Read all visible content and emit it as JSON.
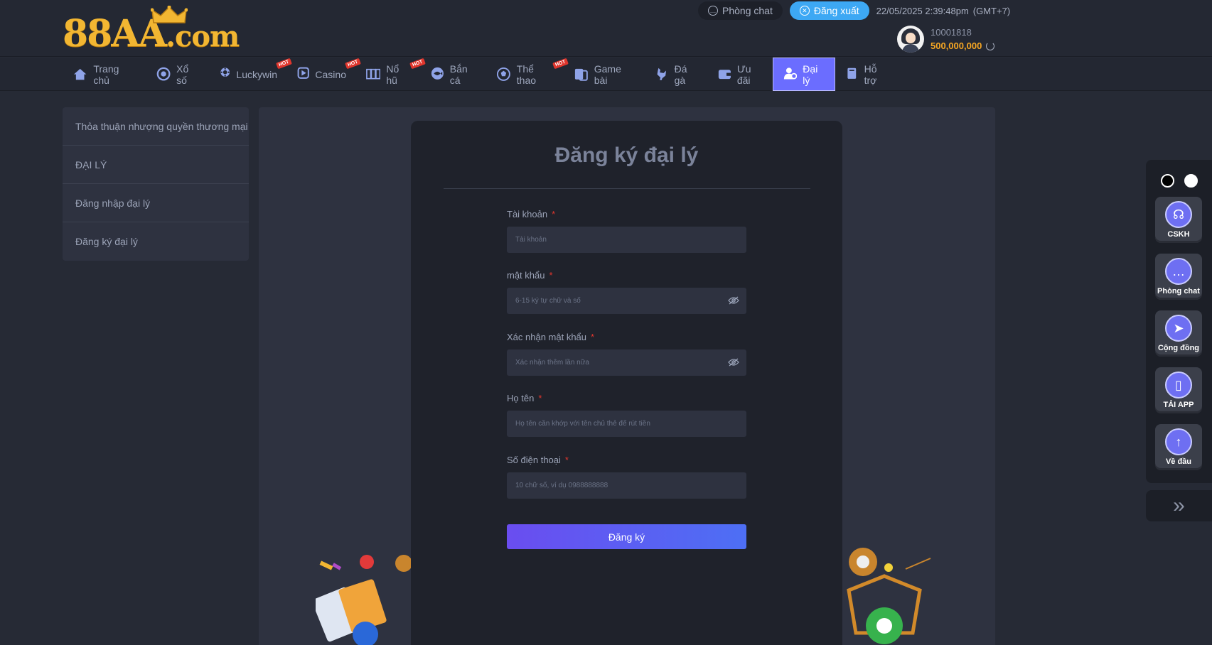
{
  "brand": {
    "logo_text": "88AA",
    "logo_suffix": ".com"
  },
  "header": {
    "chat_label": "Phòng chat",
    "logout_label": "Đăng xuất",
    "datetime": "22/05/2025 2:39:48pm",
    "timezone": "(GMT+7)",
    "user_id": "10001818",
    "balance": "500,000,000"
  },
  "nav": {
    "items": [
      {
        "label": "Trang chủ",
        "icon": "home-icon",
        "hot": false
      },
      {
        "label": "Xổ số",
        "icon": "lottery-coin-icon",
        "hot": false
      },
      {
        "label": "Luckywin",
        "icon": "luckywin-icon",
        "hot": true
      },
      {
        "label": "Casino",
        "icon": "play-icon",
        "hot": true
      },
      {
        "label": "Nổ hũ",
        "icon": "slot-icon",
        "hot": true
      },
      {
        "label": "Bắn cá",
        "icon": "fish-icon",
        "hot": false
      },
      {
        "label": "Thể thao",
        "icon": "ball-icon",
        "hot": true
      },
      {
        "label": "Game bài",
        "icon": "cards-icon",
        "hot": false
      },
      {
        "label": "Đá gà",
        "icon": "rooster-icon",
        "hot": false
      },
      {
        "label": "Ưu đãi",
        "icon": "wallet-icon",
        "hot": false
      },
      {
        "label": "Đại lý",
        "icon": "agent-icon",
        "hot": false,
        "active": true
      },
      {
        "label": "Hỗ trợ",
        "icon": "book-icon",
        "hot": false
      }
    ],
    "hot_badge": "HOT"
  },
  "sidebar": {
    "items": [
      "Thỏa thuận nhượng quyền thương mại",
      "ĐẠI LÝ",
      "Đăng nhập đại lý",
      "Đăng ký đại lý"
    ]
  },
  "form": {
    "title": "Đăng ký đại lý",
    "required_mark": "*",
    "fields": [
      {
        "label": "Tài khoản",
        "placeholder": "Tài khoản"
      },
      {
        "label": "mật khẩu",
        "placeholder": "6-15 ký tự chữ và số"
      },
      {
        "label": "Xác nhận mật khẩu",
        "placeholder": "Xác nhận thêm lần nữa"
      },
      {
        "label": "Họ tên",
        "placeholder": "Họ tên cần khớp với tên chủ thẻ để rút tiền"
      },
      {
        "label": "Số điện thoại",
        "placeholder": "10 chữ số, ví dụ 0988888888"
      }
    ],
    "submit_label": "Đăng ký"
  },
  "floatbar": {
    "buttons": [
      {
        "label": "CSKH",
        "icon": "headset-icon"
      },
      {
        "label": "Phòng chat",
        "icon": "chat-bubble-icon"
      },
      {
        "label": "Cộng đồng",
        "icon": "send-icon"
      },
      {
        "label": "TẢI APP",
        "icon": "phone-icon"
      },
      {
        "label": "Về đầu",
        "icon": "arrow-up-icon"
      }
    ]
  },
  "colors": {
    "accent": "#6b6dff",
    "gold": "#f2b632",
    "balance": "#f5a623",
    "logout": "#3da8f4",
    "required": "#e0362d"
  }
}
